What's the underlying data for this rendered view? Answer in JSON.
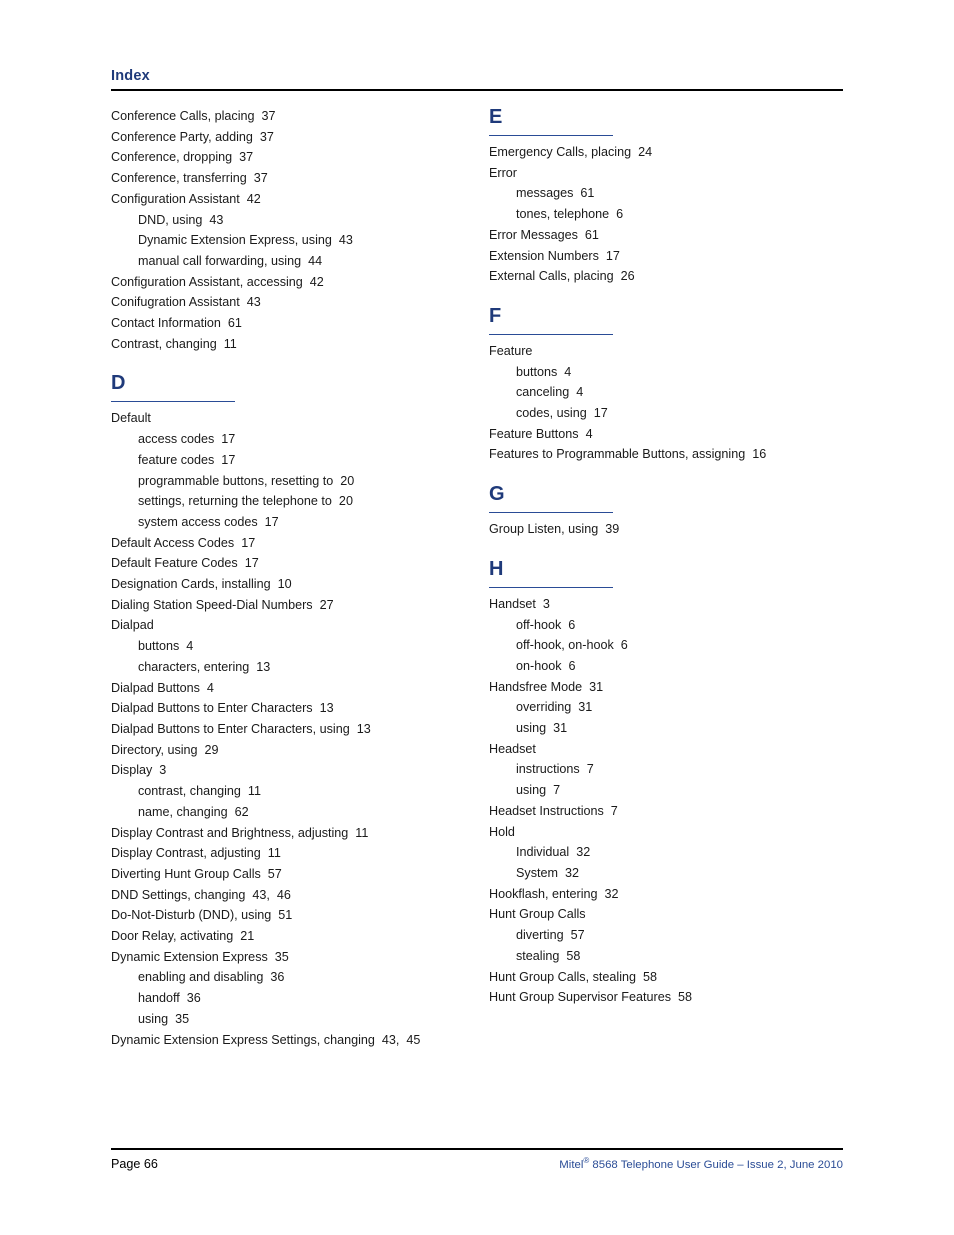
{
  "header": {
    "title": "Index"
  },
  "footer": {
    "page_label": "Page 66",
    "guide_brand": "Mitel",
    "guide_reg": "®",
    "guide_text": " 8568 Telephone User Guide – Issue 2, June 2010",
    "accent_color": "#2a4c96"
  },
  "theme": {
    "heading_blue": "#1f3a7a",
    "rule_blue": "#2a4c96",
    "rule_black": "#000000",
    "body_text": "#1a1a1a"
  },
  "columns": [
    {
      "name": "left-column",
      "blocks": [
        {
          "letter": null,
          "entries": [
            {
              "text": "Conference Calls, placing  37",
              "level": 0
            },
            {
              "text": "Conference Party, adding  37",
              "level": 0
            },
            {
              "text": "Conference, dropping  37",
              "level": 0
            },
            {
              "text": "Conference, transferring  37",
              "level": 0
            },
            {
              "text": "Configuration Assistant  42",
              "level": 0
            },
            {
              "text": "DND, using  43",
              "level": 1
            },
            {
              "text": "Dynamic Extension Express, using  43",
              "level": 1
            },
            {
              "text": "manual call forwarding, using  44",
              "level": 1
            },
            {
              "text": "Configuration Assistant, accessing  42",
              "level": 0
            },
            {
              "text": "Conifugration Assistant  43",
              "level": 0
            },
            {
              "text": "Contact Information  61",
              "level": 0
            },
            {
              "text": "Contrast, changing  11",
              "level": 0
            }
          ]
        },
        {
          "letter": "D",
          "entries": [
            {
              "text": "Default",
              "level": 0
            },
            {
              "text": "access codes  17",
              "level": 1
            },
            {
              "text": "feature codes  17",
              "level": 1
            },
            {
              "text": "programmable buttons, resetting to  20",
              "level": 1
            },
            {
              "text": "settings, returning the telephone to  20",
              "level": 1
            },
            {
              "text": "system access codes  17",
              "level": 1
            },
            {
              "text": "Default Access Codes  17",
              "level": 0
            },
            {
              "text": "Default Feature Codes  17",
              "level": 0
            },
            {
              "text": "Designation Cards, installing  10",
              "level": 0
            },
            {
              "text": "Dialing Station Speed-Dial Numbers  27",
              "level": 0
            },
            {
              "text": "Dialpad",
              "level": 0
            },
            {
              "text": "buttons  4",
              "level": 1
            },
            {
              "text": "characters, entering  13",
              "level": 1
            },
            {
              "text": "Dialpad Buttons  4",
              "level": 0
            },
            {
              "text": "Dialpad Buttons to Enter Characters  13",
              "level": 0
            },
            {
              "text": "Dialpad Buttons to Enter Characters, using  13",
              "level": 0
            },
            {
              "text": "Directory, using  29",
              "level": 0
            },
            {
              "text": "Display  3",
              "level": 0
            },
            {
              "text": "contrast, changing  11",
              "level": 1
            },
            {
              "text": "name, changing  62",
              "level": 1
            },
            {
              "text": "Display Contrast and Brightness, adjusting  11",
              "level": 0
            },
            {
              "text": "Display Contrast, adjusting  11",
              "level": 0
            },
            {
              "text": "Diverting Hunt Group Calls  57",
              "level": 0
            },
            {
              "text": "DND Settings, changing  43,  46",
              "level": 0
            },
            {
              "text": "Do-Not-Disturb (DND), using  51",
              "level": 0
            },
            {
              "text": "Door Relay, activating  21",
              "level": 0
            },
            {
              "text": "Dynamic Extension Express  35",
              "level": 0
            },
            {
              "text": "enabling and disabling  36",
              "level": 1
            },
            {
              "text": "handoff  36",
              "level": 1
            },
            {
              "text": "using  35",
              "level": 1
            },
            {
              "text": "Dynamic Extension Express Settings, changing  43,  45",
              "level": 0
            }
          ]
        }
      ]
    },
    {
      "name": "right-column",
      "blocks": [
        {
          "letter": "E",
          "entries": [
            {
              "text": "Emergency Calls, placing  24",
              "level": 0
            },
            {
              "text": "Error",
              "level": 0
            },
            {
              "text": "messages  61",
              "level": 1
            },
            {
              "text": "tones, telephone  6",
              "level": 1
            },
            {
              "text": "Error Messages  61",
              "level": 0
            },
            {
              "text": "Extension Numbers  17",
              "level": 0
            },
            {
              "text": "External Calls, placing  26",
              "level": 0
            }
          ]
        },
        {
          "letter": "F",
          "entries": [
            {
              "text": "Feature",
              "level": 0
            },
            {
              "text": "buttons  4",
              "level": 1
            },
            {
              "text": "canceling  4",
              "level": 1
            },
            {
              "text": "codes, using  17",
              "level": 1
            },
            {
              "text": "Feature Buttons  4",
              "level": 0
            },
            {
              "text": "Features to Programmable Buttons, assigning  16",
              "level": 0
            }
          ]
        },
        {
          "letter": "G",
          "entries": [
            {
              "text": "Group Listen, using  39",
              "level": 0
            }
          ]
        },
        {
          "letter": "H",
          "entries": [
            {
              "text": "Handset  3",
              "level": 0
            },
            {
              "text": "off-hook  6",
              "level": 1
            },
            {
              "text": "off-hook, on-hook  6",
              "level": 1
            },
            {
              "text": "on-hook  6",
              "level": 1
            },
            {
              "text": "Handsfree Mode  31",
              "level": 0
            },
            {
              "text": "overriding  31",
              "level": 1
            },
            {
              "text": "using  31",
              "level": 1
            },
            {
              "text": "Headset",
              "level": 0
            },
            {
              "text": "instructions  7",
              "level": 1
            },
            {
              "text": "using  7",
              "level": 1
            },
            {
              "text": "Headset Instructions  7",
              "level": 0
            },
            {
              "text": "Hold",
              "level": 0
            },
            {
              "text": "Individual  32",
              "level": 1
            },
            {
              "text": "System  32",
              "level": 1
            },
            {
              "text": "Hookflash, entering  32",
              "level": 0
            },
            {
              "text": "Hunt Group Calls",
              "level": 0
            },
            {
              "text": "diverting  57",
              "level": 1
            },
            {
              "text": "stealing  58",
              "level": 1
            },
            {
              "text": "Hunt Group Calls, stealing  58",
              "level": 0
            },
            {
              "text": "Hunt Group Supervisor Features  58",
              "level": 0
            }
          ]
        }
      ]
    }
  ]
}
